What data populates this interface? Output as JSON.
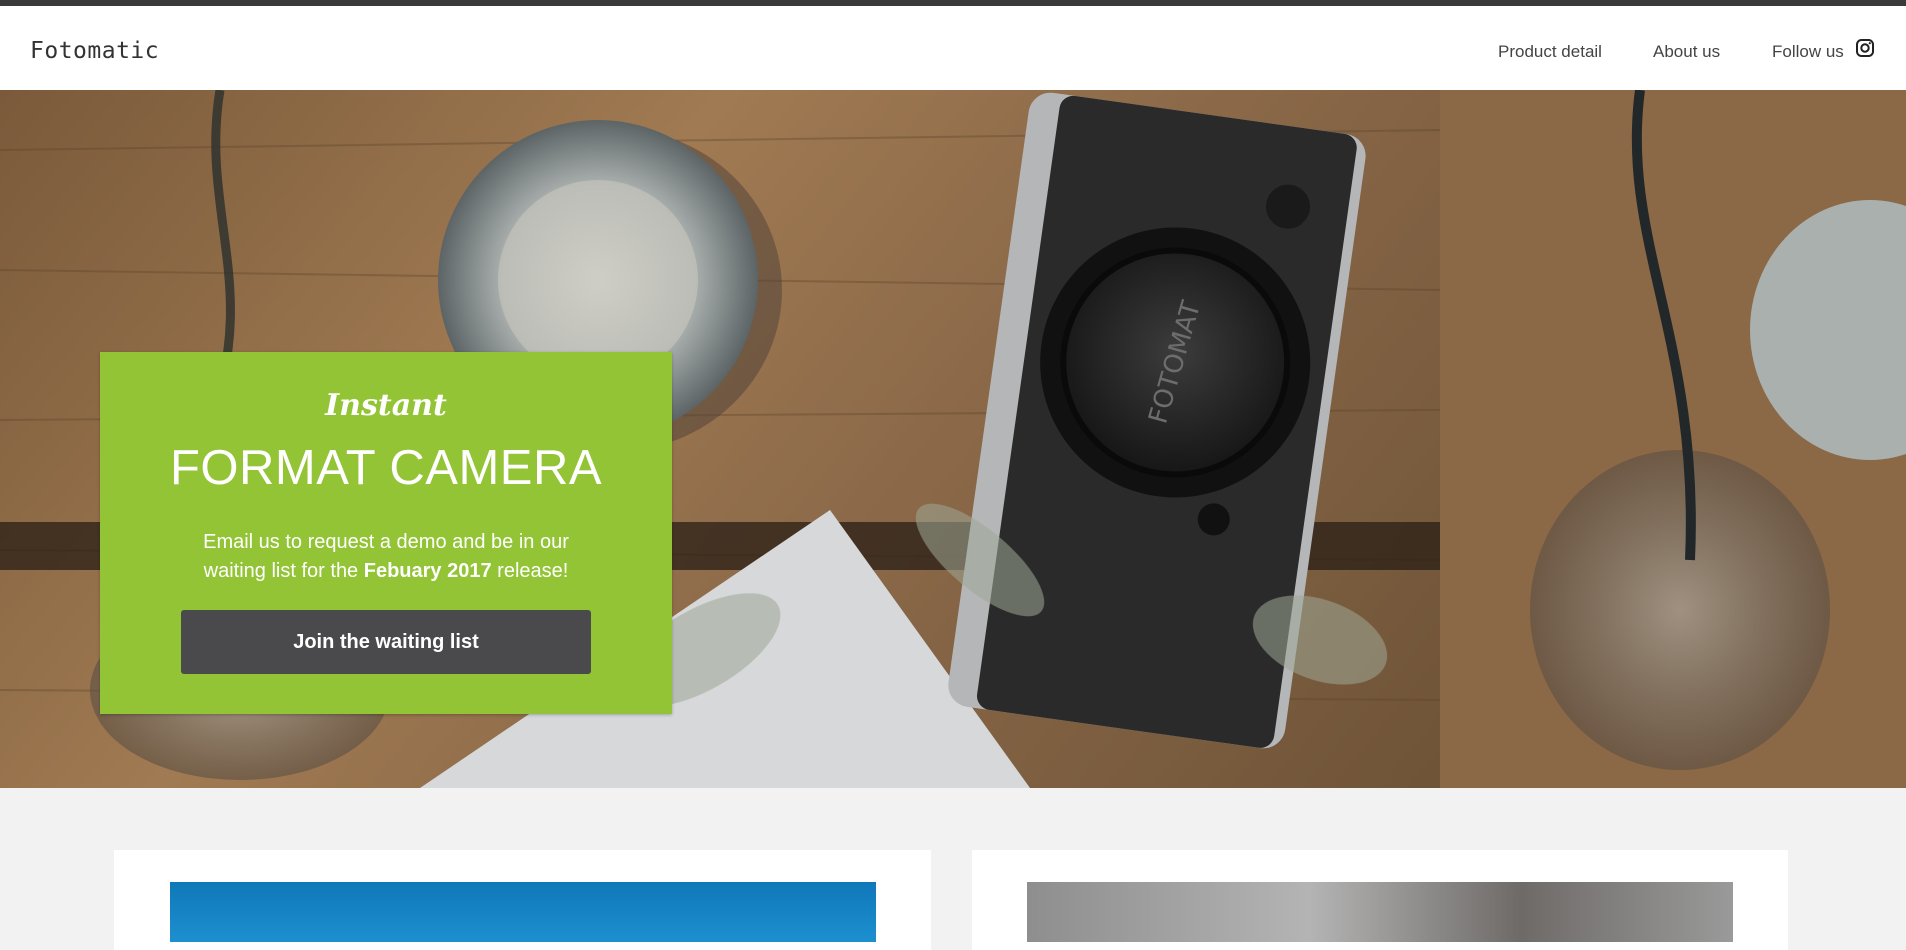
{
  "header": {
    "logo": "Fotomatic",
    "nav": {
      "product_detail": "Product detail",
      "about_us": "About us",
      "follow_us": "Follow us"
    },
    "social_icon": "instagram-icon"
  },
  "hero": {
    "lens_cap_text": "FOTOMAT",
    "promo": {
      "script": "Instant",
      "title": "FORMAT CAMERA",
      "text_before": "Email us to request a demo and be in our waiting list for the ",
      "text_bold": "Febuary 2017",
      "text_after": " release!",
      "button_label": "Join the waiting list"
    }
  },
  "colors": {
    "accent_green": "#92c435",
    "button_dark": "#4a4a4c",
    "top_bar": "#3a3a3a"
  }
}
